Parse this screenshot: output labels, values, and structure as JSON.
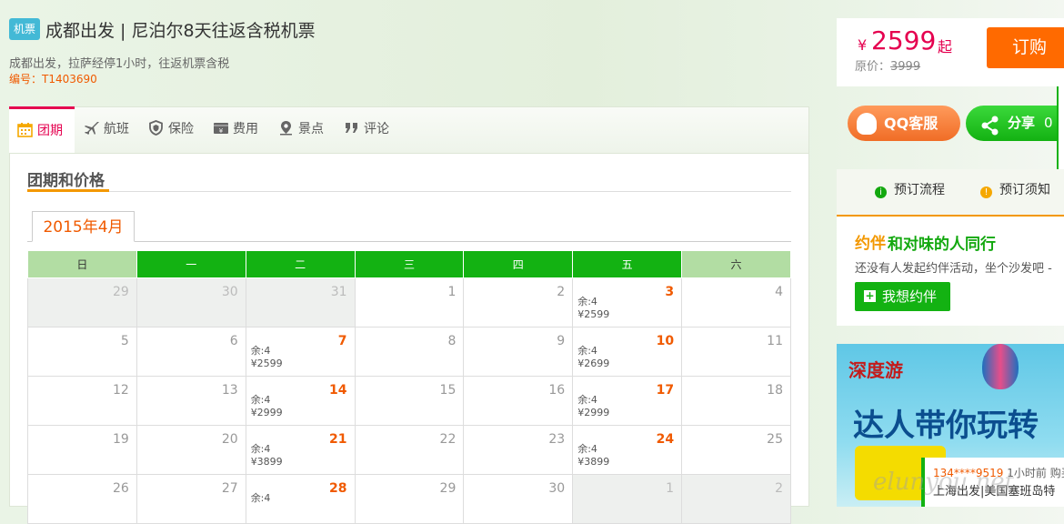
{
  "header": {
    "badge": "机票",
    "title": "成都出发 | 尼泊尔8天往返含税机票",
    "subtitle": "成都出发，拉萨经停1小时，往返机票含税",
    "code": "编号：T1403690"
  },
  "price": {
    "yen": "¥",
    "value": "2599",
    "suffix": "起",
    "original_label": "原价：",
    "original_value": "3999",
    "book_label": "订购"
  },
  "actions": {
    "qq_label": "QQ客服",
    "share_label": "分享",
    "share_count": "0"
  },
  "steps": {
    "flow_label": "预订流程",
    "notice_label": "预订须知"
  },
  "yueban": {
    "logo": "约伴",
    "title": "和对味的人同行",
    "desc": "还没有人发起约伴活动，坐个沙发吧 -",
    "button": "我想约伴"
  },
  "ad": {
    "logo": "深度游",
    "text": "达人带你玩转"
  },
  "notice": {
    "phone": "134****9519",
    "time": " 1小时前 购买",
    "product": "上海出发|美国塞班岛特"
  },
  "watermark": "elunyou.net",
  "tabs": [
    {
      "label": "团期"
    },
    {
      "label": "航班"
    },
    {
      "label": "保险"
    },
    {
      "label": "费用"
    },
    {
      "label": "景点"
    },
    {
      "label": "评论"
    }
  ],
  "calendar": {
    "section_title": "团期和价格",
    "month": "2015年4月",
    "weekdays": [
      "日",
      "一",
      "二",
      "三",
      "四",
      "五",
      "六"
    ],
    "weeks": [
      [
        {
          "d": "29",
          "o": true
        },
        {
          "d": "30",
          "o": true
        },
        {
          "d": "31",
          "o": true
        },
        {
          "d": "1"
        },
        {
          "d": "2"
        },
        {
          "d": "3",
          "r": "余:4",
          "p": "¥2599"
        },
        {
          "d": "4"
        }
      ],
      [
        {
          "d": "5"
        },
        {
          "d": "6"
        },
        {
          "d": "7",
          "r": "余:4",
          "p": "¥2599"
        },
        {
          "d": "8"
        },
        {
          "d": "9"
        },
        {
          "d": "10",
          "r": "余:4",
          "p": "¥2699"
        },
        {
          "d": "11"
        }
      ],
      [
        {
          "d": "12"
        },
        {
          "d": "13"
        },
        {
          "d": "14",
          "r": "余:4",
          "p": "¥2999"
        },
        {
          "d": "15"
        },
        {
          "d": "16"
        },
        {
          "d": "17",
          "r": "余:4",
          "p": "¥2999"
        },
        {
          "d": "18"
        }
      ],
      [
        {
          "d": "19"
        },
        {
          "d": "20"
        },
        {
          "d": "21",
          "r": "余:4",
          "p": "¥3899"
        },
        {
          "d": "22"
        },
        {
          "d": "23"
        },
        {
          "d": "24",
          "r": "余:4",
          "p": "¥3899"
        },
        {
          "d": "25"
        }
      ],
      [
        {
          "d": "26"
        },
        {
          "d": "27"
        },
        {
          "d": "28",
          "r": "余:4",
          "p": ""
        },
        {
          "d": "29"
        },
        {
          "d": "30"
        },
        {
          "d": "1",
          "o": true
        },
        {
          "d": "2",
          "o": true
        }
      ]
    ]
  }
}
